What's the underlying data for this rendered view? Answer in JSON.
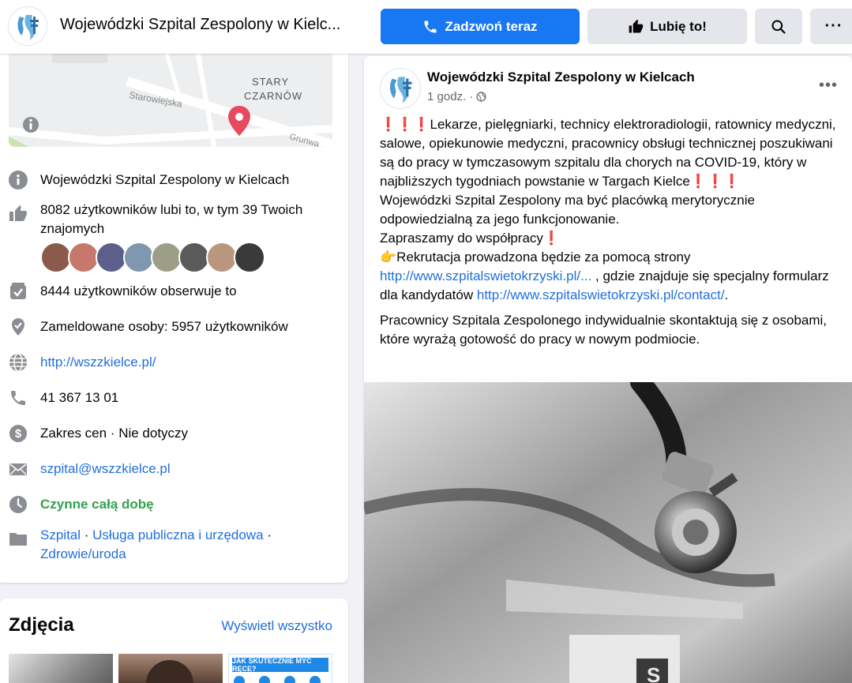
{
  "header": {
    "title": "Wojewódzki Szpital Zespolony w Kielc...",
    "call_label": "Zadzwoń teraz",
    "like_label": "Lubię to!",
    "more_icon": "···"
  },
  "map": {
    "labels": [
      "Starowiejska",
      "STARY",
      "CZARNÓW",
      "Grunwa"
    ]
  },
  "info": {
    "name": "Wojewódzki Szpital Zespolony w Kielcach",
    "likes_line1": "8082 użytkowników lubi to, w tym 39 Twoich",
    "likes_line2": "znajomych",
    "followers": "8444 użytkowników obserwuje to",
    "checkins": "Zameldowane osoby: 5957 użytkowników",
    "website": "http://wszzkielce.pl/",
    "phone": "41 367 13 01",
    "price": "Zakres cen · Nie dotyczy",
    "email": "szpital@wszzkielce.pl",
    "hours": "Czynne całą dobę",
    "category1": "Szpital",
    "category_sep1": " · ",
    "category2": "Usługa publiczna i urzędowa",
    "category_sep2": " ·",
    "category3": "Zdrowie/uroda"
  },
  "photos": {
    "title": "Zdjęcia",
    "view_all": "Wyświetl wszystko",
    "thumb3_text": "JAK SKUTECZNIE MYĆ RĘCE?"
  },
  "post": {
    "author": "Wojewódzki Szpital Zespolony w Kielcach",
    "time": "1 godz. ·",
    "line1": "❗❗❗Lekarze, pielęgniarki, technicy elektroradiologii, ratownicy medyczni, salowe, opiekunowie medyczni, pracownicy obsługi technicznej poszukiwani są do pracy w tymczasowym szpitalu dla chorych na COVID-19, który w najbliższych tygodniach powstanie w Targach Kielce❗❗❗",
    "line2": "Wojewódzki Szpital Zespolony ma być placówką merytorycznie odpowiedzialną za jego funkcjonowanie.",
    "line3": "Zapraszamy do współpracy❗",
    "line4_prefix": "👉Rekrutacja prowadzona będzie za pomocą strony",
    "link1": "http://www.szpitalswietokrzyski.pl/...",
    "line4_mid": " , gdzie znajduje się specjalny formularz dla kandydatów ",
    "link2": "http://www.szpitalswietokrzyski.pl/contact/",
    "line4_end": ".",
    "line5": "Pracownicy Szpitala Zespolonego indywidualnie skontaktują się z osobami, które wyrażą gotowość do pracy w nowym podmiocie."
  },
  "colors": {
    "accent": "#1877f2",
    "link": "#216fdb",
    "green": "#31a24c"
  }
}
